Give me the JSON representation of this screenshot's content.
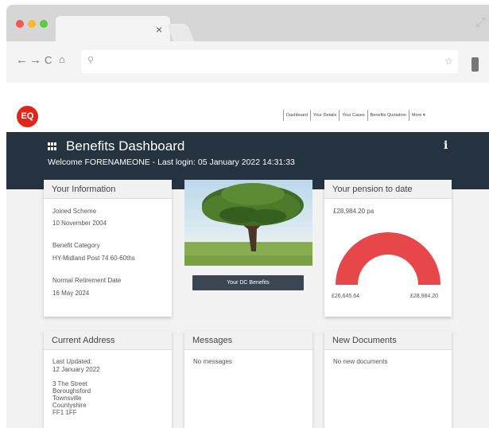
{
  "browser": {
    "tab_close": "×"
  },
  "header": {
    "logo_text": "EQ",
    "nav": [
      "Dashboard",
      "Your Details",
      "Your Cases",
      "Benefits Quotation",
      "More ▾"
    ]
  },
  "banner": {
    "title": "Benefits Dashboard",
    "welcome": "Welcome FORENAMEONE - Last login: 05 January 2022 14:31:33",
    "info_glyph": "i"
  },
  "your_information": {
    "title": "Your Information",
    "joined_label": "Joined Scheme",
    "joined_value": "10 November 2004",
    "category_label": "Benefit Category",
    "category_value": "HY-Midland Post 74 60-60ths",
    "retirement_label": "Normal Retirement Date",
    "retirement_value": "16 May 2024"
  },
  "dc_benefits": {
    "button_label": "Your DC Benefits"
  },
  "pension": {
    "title": "Your pension to date",
    "amount": "£28,984.20 pa",
    "min_label": "£26,645.64",
    "max_label": "£28,984.20",
    "fill_fraction": 1.0,
    "gauge_color": "#e8474a"
  },
  "address": {
    "title": "Current Address",
    "updated_label": "Last Updated:",
    "updated_value": "12 January 2022",
    "lines": [
      "3 The Street",
      "Boroughsford",
      "Townsville",
      "Countyshire",
      "FF1 1FF"
    ]
  },
  "messages": {
    "title": "Messages",
    "empty": "No messages"
  },
  "documents": {
    "title": "New Documents",
    "empty": "No new documents"
  }
}
